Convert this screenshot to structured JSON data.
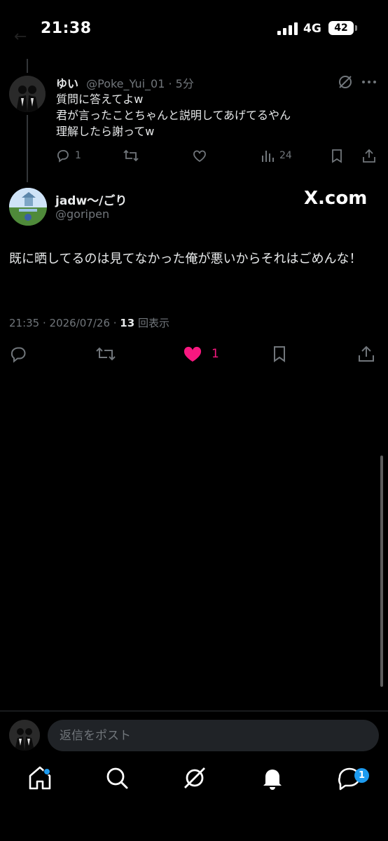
{
  "status_bar": {
    "time": "21:38",
    "network": "4G",
    "battery": "42"
  },
  "reply_post": {
    "author_name": "ゆい",
    "author_meta": "@Poke_Yui_01 · 5分",
    "lines": [
      "質問に答えてよw",
      "君が言ったことちゃんと説明してあげてるやん",
      "理解したら謝ってw"
    ],
    "reply_count": "1",
    "view_count": "24"
  },
  "main_post": {
    "author_name": "jadw〜/ごり",
    "author_handle": "@goripen",
    "watermark": "X.com",
    "text": "既に晒してるのは見てなかった俺が悪いからそれはごめんな！",
    "timestamp": "21:35 · 2026/07/26 · ",
    "views": "13",
    "views_label": " 回表示",
    "like_count": "1"
  },
  "composer": {
    "placeholder": "返信をポスト"
  },
  "tabbar": {
    "messages_badge": "1"
  },
  "colors": {
    "background": "#000000",
    "text": "#e7e9ea",
    "muted": "#71767b",
    "like": "#f91880",
    "accent": "#1d9bf0"
  },
  "icons": [
    "signal-icon",
    "battery-icon",
    "grok-icon",
    "more-icon",
    "reply-icon",
    "repost-icon",
    "like-icon",
    "views-icon",
    "bookmark-icon",
    "share-icon",
    "home-icon",
    "search-icon",
    "notifications-icon",
    "messages-icon"
  ]
}
